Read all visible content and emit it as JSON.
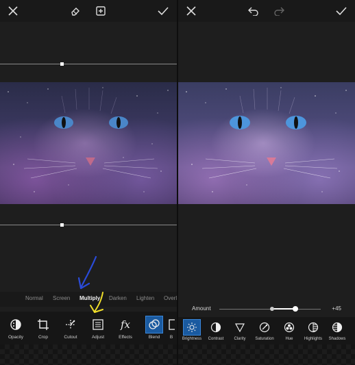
{
  "left": {
    "blend_modes": [
      "Normal",
      "Screen",
      "Multiply",
      "Darken",
      "Lighten",
      "Overla"
    ],
    "active_blend_mode": "Multiply",
    "tools": [
      {
        "label": "Opacity",
        "icon": "opacity-icon"
      },
      {
        "label": "Crop",
        "icon": "crop-icon"
      },
      {
        "label": "Cutout",
        "icon": "cutout-icon"
      },
      {
        "label": "Adjust",
        "icon": "adjust-icon"
      },
      {
        "label": "Effects",
        "icon": "effects-icon"
      },
      {
        "label": "Blend",
        "icon": "blend-icon",
        "selected": true
      },
      {
        "label": "B",
        "icon": "partial-tool-icon"
      }
    ],
    "effects_glyph": "fx"
  },
  "right": {
    "amount_label": "Amount",
    "amount_value": "+45",
    "adjustments": [
      {
        "label": "Brightness",
        "icon": "brightness-icon",
        "selected": true
      },
      {
        "label": "Contrast",
        "icon": "contrast-icon"
      },
      {
        "label": "Clarity",
        "icon": "clarity-icon"
      },
      {
        "label": "Saturation",
        "icon": "saturation-icon"
      },
      {
        "label": "Hue",
        "icon": "hue-icon"
      },
      {
        "label": "Highlights",
        "icon": "highlights-icon"
      },
      {
        "label": "Shadows",
        "icon": "shadows-icon"
      }
    ]
  },
  "colors": {
    "accent": "#1a5aa0",
    "annotation_blue": "#2a4bd8",
    "annotation_yellow": "#f2e02a"
  }
}
